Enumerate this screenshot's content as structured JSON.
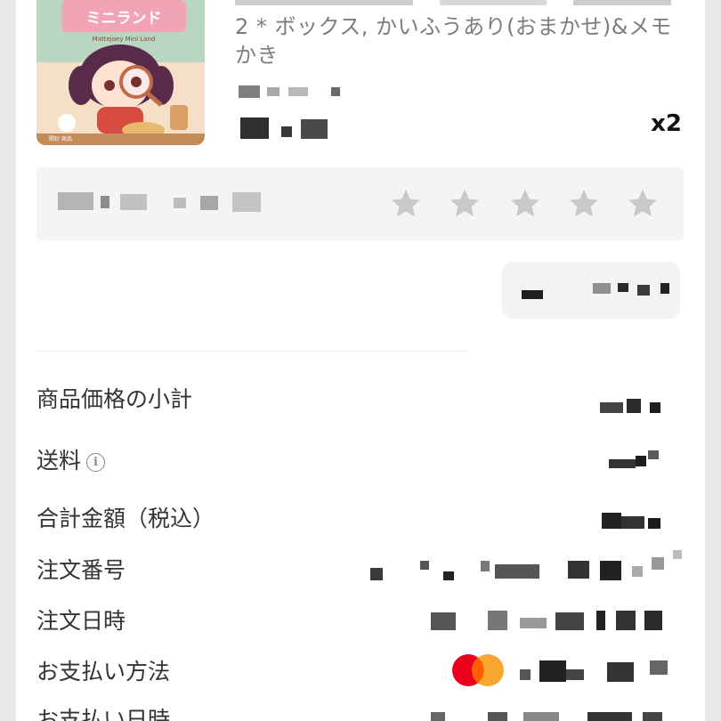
{
  "product": {
    "variant_text": "2 * ボックス, かいふうあり(おまかせ)&メモかき",
    "quantity": "x2",
    "thumbnail": {
      "logo_text": "ミニランド",
      "logo_subtext": "Mattejoey Mini Land",
      "corner_text": "開封 商品"
    }
  },
  "rating": {
    "stars_total": 5,
    "stars_icon": "star-icon"
  },
  "summary": {
    "rows": [
      {
        "label": "商品価格の小計"
      },
      {
        "label": "送料",
        "info_icon": "info-icon"
      },
      {
        "label": "合計金額（税込）"
      },
      {
        "label": "注文番号"
      },
      {
        "label": "注文日時"
      },
      {
        "label": "お支払い方法",
        "payment_brand_icon": "mastercard-icon"
      },
      {
        "label": "お支払い日時"
      }
    ]
  },
  "colors": {
    "background": "#ffffff",
    "panel": "#f4f4f4",
    "muted_text": "#7d7d7d",
    "mastercard_red": "#eb001b",
    "mastercard_orange": "#f79e1b"
  }
}
